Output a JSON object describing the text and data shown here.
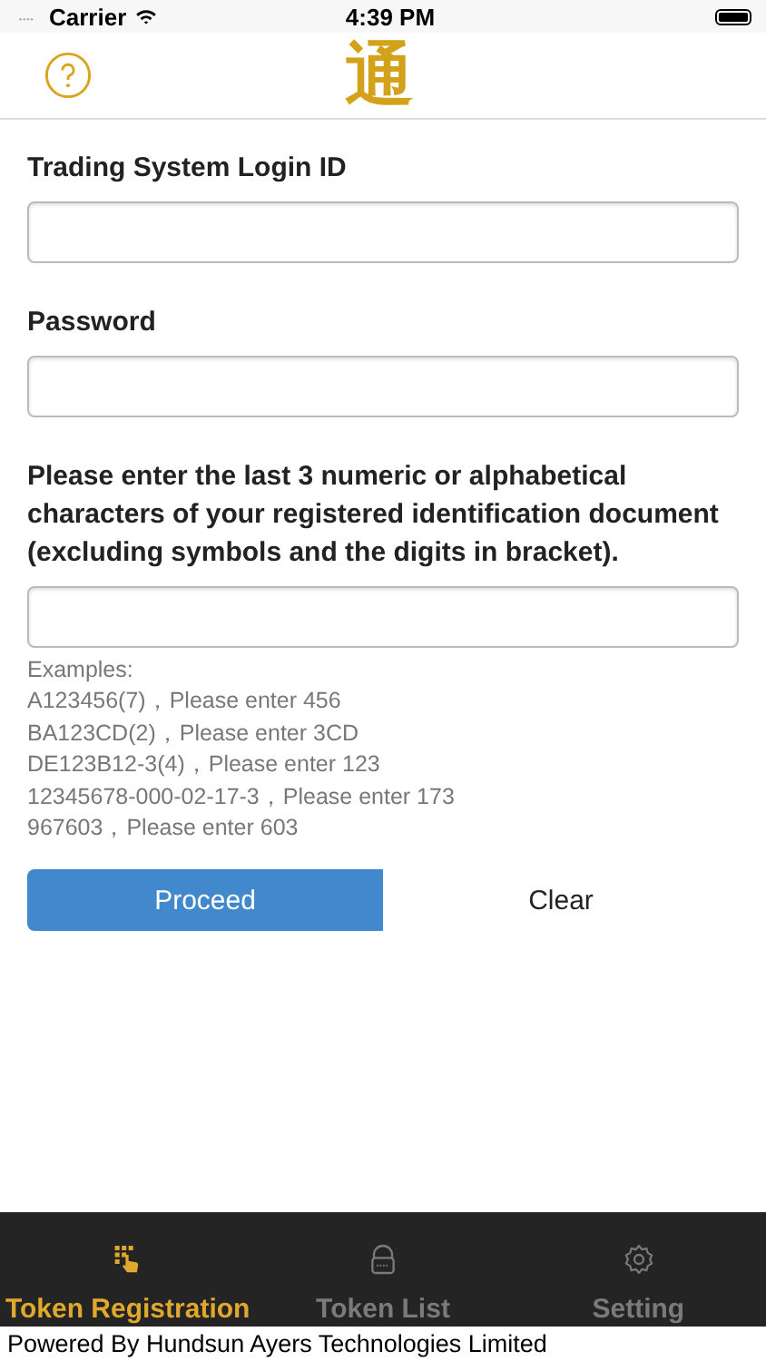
{
  "status_bar": {
    "carrier": "Carrier",
    "time": "4:39 PM"
  },
  "header": {
    "logo": "通"
  },
  "fields": [
    {
      "label": "Trading System Login ID"
    },
    {
      "label": "Password"
    },
    {
      "label": "Please enter the last 3 numeric or alphabetical characters of your registered identification document (excluding symbols and the digits in bracket)."
    }
  ],
  "examples": [
    "Examples:",
    "A123456(7)，Please enter 456",
    "BA123CD(2)，Please enter 3CD",
    "DE123B12-3(4)，Please enter 123",
    "12345678-000-02-17-3，Please enter 173",
    "967603，Please enter 603"
  ],
  "buttons": [
    {
      "label": "Proceed",
      "kind": "primary"
    },
    {
      "label": "Clear",
      "kind": "plain"
    }
  ],
  "tabs": [
    {
      "label": "Token Registration",
      "kind": "keypad",
      "selected": true
    },
    {
      "label": "Token List",
      "kind": "lock",
      "selected": false
    },
    {
      "label": "Setting",
      "kind": "gear",
      "selected": false
    }
  ],
  "footer": "Powered By Hundsun Ayers Technologies Limited"
}
